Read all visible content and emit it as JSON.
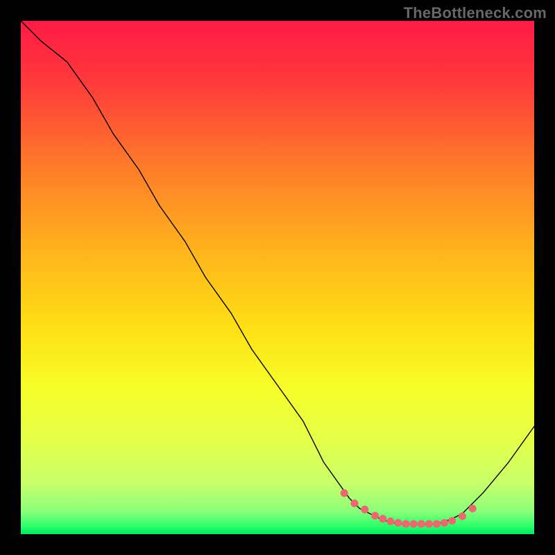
{
  "watermark": "TheBottleneck.com",
  "chart_data": {
    "type": "line",
    "title": "",
    "xlabel": "",
    "ylabel": "",
    "xlim": [
      0,
      100
    ],
    "ylim": [
      0,
      100
    ],
    "series": [
      {
        "name": "curve",
        "x": [
          0,
          4,
          9,
          14,
          18,
          23,
          27,
          32,
          36,
          41,
          45,
          50,
          55,
          59,
          64,
          65,
          66,
          68,
          70,
          72,
          74,
          76,
          78,
          80,
          82,
          84,
          86,
          90,
          95,
          100
        ],
        "y": [
          100,
          96,
          92,
          85,
          78,
          71,
          64,
          57,
          50,
          43,
          36,
          29,
          22,
          14,
          7,
          6,
          5,
          4,
          3,
          2.3,
          2,
          2,
          2,
          2,
          2.3,
          3,
          4,
          8,
          14,
          21
        ]
      }
    ],
    "markers": {
      "name": "highlight",
      "x": [
        63,
        65,
        67,
        69,
        70.5,
        72,
        73.5,
        75,
        76.5,
        78,
        79.5,
        81,
        82.5,
        84,
        86,
        88
      ],
      "y": [
        8,
        6,
        4.8,
        3.6,
        3,
        2.5,
        2.2,
        2,
        2,
        2,
        2,
        2,
        2.2,
        2.6,
        3.5,
        5
      ]
    },
    "gradient_stops": [
      {
        "offset": 0.0,
        "color": "#ff1a46"
      },
      {
        "offset": 0.12,
        "color": "#ff3a3a"
      },
      {
        "offset": 0.28,
        "color": "#ff7a2a"
      },
      {
        "offset": 0.45,
        "color": "#ffb41c"
      },
      {
        "offset": 0.6,
        "color": "#ffe015"
      },
      {
        "offset": 0.72,
        "color": "#f6ff2a"
      },
      {
        "offset": 0.82,
        "color": "#e4ff4a"
      },
      {
        "offset": 0.9,
        "color": "#c8ff6a"
      },
      {
        "offset": 0.955,
        "color": "#8cff7a"
      },
      {
        "offset": 0.985,
        "color": "#2bff6a"
      },
      {
        "offset": 1.0,
        "color": "#00e865"
      }
    ],
    "marker_color": "#e86a6f",
    "curve_color": "#000000"
  }
}
